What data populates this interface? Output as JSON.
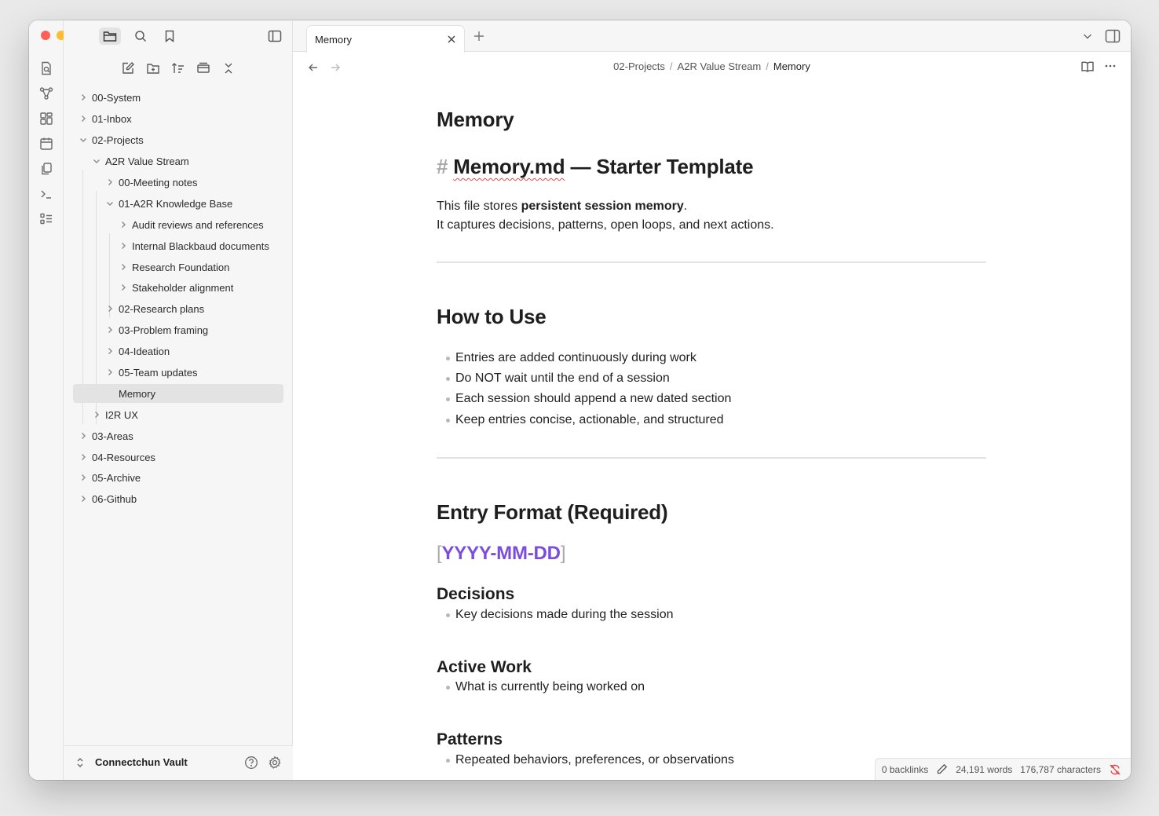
{
  "sidebar": {
    "vault_name": "Connectchun Vault",
    "tree": [
      {
        "label": "00-System"
      },
      {
        "label": "01-Inbox"
      },
      {
        "label": "02-Projects"
      },
      {
        "label": "A2R Value Stream"
      },
      {
        "label": "00-Meeting notes"
      },
      {
        "label": "01-A2R Knowledge Base"
      },
      {
        "label": "Audit reviews and references"
      },
      {
        "label": "Internal Blackbaud documents"
      },
      {
        "label": "Research Foundation"
      },
      {
        "label": "Stakeholder alignment"
      },
      {
        "label": "02-Research plans"
      },
      {
        "label": "03-Problem framing"
      },
      {
        "label": "04-Ideation"
      },
      {
        "label": "05-Team updates"
      },
      {
        "label": "Memory"
      },
      {
        "label": "I2R UX"
      },
      {
        "label": "03-Areas"
      },
      {
        "label": "04-Resources"
      },
      {
        "label": "05-Archive"
      },
      {
        "label": "06-Github"
      }
    ]
  },
  "tab": {
    "title": "Memory"
  },
  "breadcrumb": {
    "part1": "02-Projects",
    "part2": "A2R Value Stream",
    "current": "Memory",
    "sep": "/"
  },
  "doc": {
    "title": "Memory",
    "h1_hash": "#",
    "h1_name": "Memory.md",
    "h1_rest": " — Starter Template",
    "intro_pre": "This file stores ",
    "intro_bold": "persistent session memory",
    "intro_post": ".",
    "intro_line2": "It captures decisions, patterns, open loops, and next actions.",
    "how_heading": "How to Use",
    "how_items": [
      "Entries are added continuously during work",
      "Do NOT wait until the end of a session",
      "Each session should append a new dated section",
      "Keep entries concise, actionable, and structured"
    ],
    "format_heading": "Entry Format (Required)",
    "link_open": "[",
    "link_text": "YYYY-MM-DD",
    "link_close": "]",
    "decisions_heading": "Decisions",
    "decisions_item": "Key decisions made during the session",
    "active_heading": "Active Work",
    "active_item": "What is currently being worked on",
    "patterns_heading": "Patterns",
    "patterns_item": "Repeated behaviors, preferences, or observations"
  },
  "status": {
    "backlinks": "0 backlinks",
    "words": "24,191 words",
    "chars": "176,787 characters"
  },
  "colors": {
    "accent": "#7c4ddb",
    "close": "#ff5f57",
    "minimize": "#febc2e",
    "zoom": "#28c840",
    "sync_error": "#e5484d"
  }
}
